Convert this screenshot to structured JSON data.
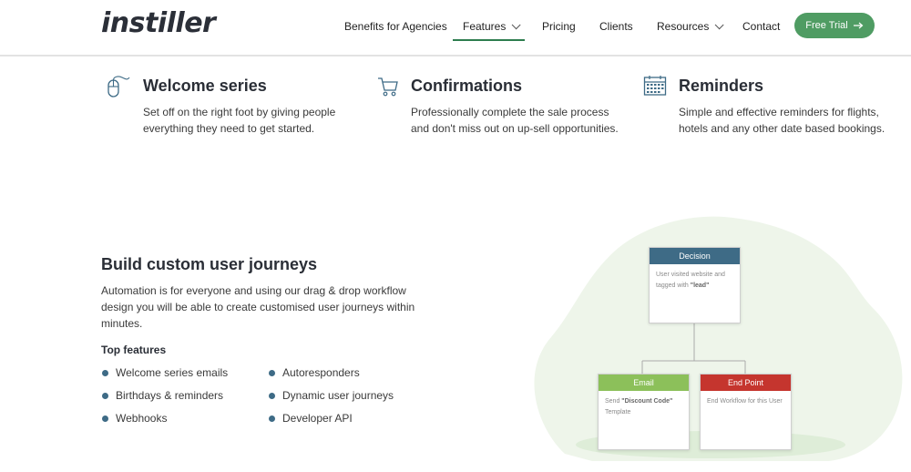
{
  "header": {
    "logo": "instiller",
    "nav": [
      {
        "label": "Benefits for Agencies"
      },
      {
        "label": "Features"
      },
      {
        "label": "Pricing"
      },
      {
        "label": "Clients"
      },
      {
        "label": "Resources"
      },
      {
        "label": "Contact"
      }
    ],
    "cta_label": "Free Trial",
    "accent": "#4f9c63"
  },
  "features": [
    {
      "title": "Welcome series",
      "desc": "Set off on the right foot by giving people everything they need to get started.",
      "icon": "mouse-icon"
    },
    {
      "title": "Confirmations",
      "desc": "Professionally complete the sale process and don't miss out on up-sell opportunities.",
      "icon": "cart-icon"
    },
    {
      "title": "Reminders",
      "desc": "Simple and effective reminders for flights, hotels and any other date based bookings.",
      "icon": "calendar-icon"
    }
  ],
  "journeys": {
    "title": "Build custom user journeys",
    "desc": "Automation is for everyone and using our drag & drop workflow design you will be able to create customised user journeys within minutes.",
    "top_features_label": "Top features",
    "list_left": [
      "Welcome series emails",
      "Birthdays & reminders",
      "Webhooks"
    ],
    "list_right": [
      "Autoresponders",
      "Dynamic user journeys",
      "Developer API"
    ]
  },
  "diagram": {
    "decision": {
      "title": "Decision",
      "text1": "User visited website and tagged with ",
      "bold": "\"lead\"",
      "color": "#3e6b86"
    },
    "email": {
      "title": "Email",
      "text1": "Send ",
      "bold": "\"Discount Code\"",
      "text2": " Template",
      "color": "#8cc05a"
    },
    "end": {
      "title": "End Point",
      "text1": "End Workflow for this User",
      "color": "#c5352e"
    }
  }
}
